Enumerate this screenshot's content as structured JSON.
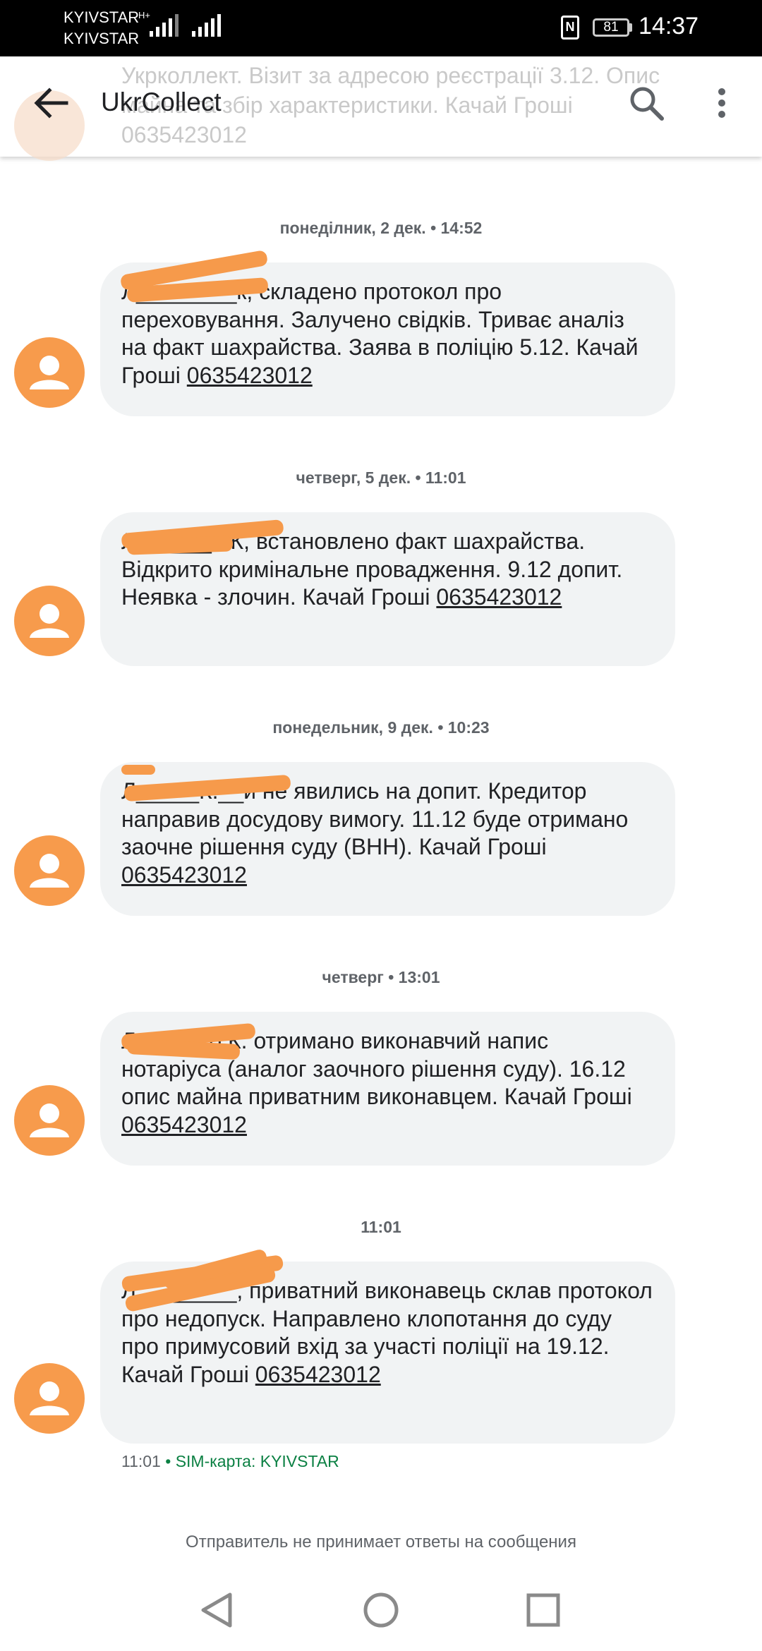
{
  "status_bar": {
    "carrier_1": "KYIVSTAR",
    "carrier_2": "KYIVSTAR",
    "network_type": "H+",
    "battery": "81",
    "time": "14:37"
  },
  "app_bar": {
    "title": "UkrCollect",
    "ghost_text": "Укрколлект. Візит за адресою реєстрації 3.12. Опис майна та збір характеристики. Качай Гроші 0635423012"
  },
  "messages": [
    {
      "timestamp": "понеділник, 2 дек. • 14:52",
      "text": "Л________к, складено протокол про переховування. Залучено свідків. Триває аналіз на факт шахрайства. Заява в поліцію 5.12. Качай Гроші ",
      "phone": "0635423012"
    },
    {
      "timestamp": "четверг, 5 дек. • 11:01",
      "text": "Л______о К, встановлено факт шахрайства. Відкрито кримінальне провадження. 9.12 допит. Неявка - злочин. Качай Гроші ",
      "phone": "0635423012"
    },
    {
      "timestamp": "понедельник, 9 дек. • 10:23",
      "text": "Л_____К.__и не явились на допит. Кредитор направив досудову вимогу. 11.12 буде отримано заочне рішення суду (ВНН). Качай Гроші ",
      "phone": "0635423012"
    },
    {
      "timestamp": "четверг • 13:01",
      "text": "Л_____ко К. отримано виконавчий напис нотаріуса (аналог заочного рішення суду). 16.12 опис майна приватним виконавцем. Качай Гроші ",
      "phone": "0635423012"
    },
    {
      "timestamp": "11:01",
      "text": "Л________, приватний виконавець склав протокол про недопуск. Направлено клопотання до суду про примусовий вхід за участі поліції на 19.12. Качай Гроші ",
      "phone": "0635423012"
    }
  ],
  "last_message_meta": {
    "time": "11:01",
    "sim": "• SIM-карта: KYIVSTAR"
  },
  "footer_note": "Отправитель не принимает ответы на сообщения",
  "colors": {
    "avatar": "#f79b4c",
    "bubble": "#f1f3f4",
    "redaction": "#f69a4b",
    "sim_label": "#0b8043"
  },
  "icons": {
    "back": "arrow-back-icon",
    "search": "search-icon",
    "more": "more-vert-icon",
    "avatar": "person-icon",
    "nav_back": "triangle-back-icon",
    "nav_home": "circle-home-icon",
    "nav_recents": "square-recents-icon"
  }
}
